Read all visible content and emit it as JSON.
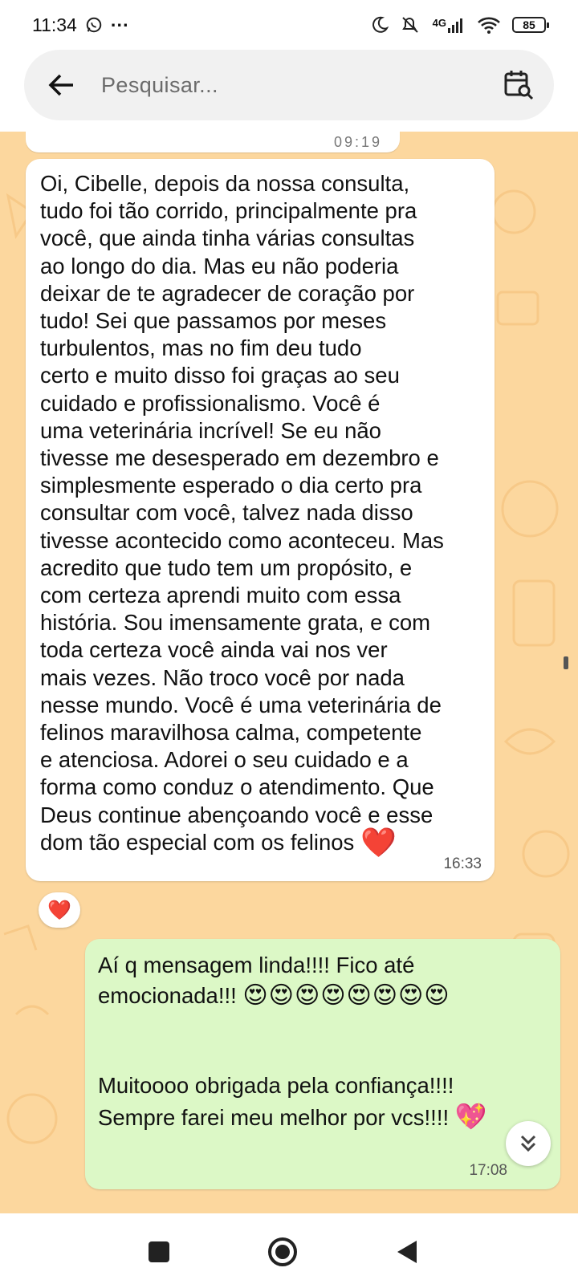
{
  "status_bar": {
    "time": "11:34",
    "dots": "···",
    "network": "4G",
    "battery": "85"
  },
  "search": {
    "placeholder": "Pesquisar..."
  },
  "chat": {
    "previous_time": "09:19",
    "incoming": {
      "text": "Oi, Cibelle, depois da nossa consulta,\ntudo foi tão corrido, principalmente pra\nvocê, que ainda tinha várias consultas\nao longo do dia. Mas eu não poderia\ndeixar de te agradecer de coração por\ntudo! Sei que passamos por meses\nturbulentos, mas no fim deu tudo\ncerto e muito disso foi graças ao seu\ncuidado e profissionalismo. Você é\numa veterinária incrível! Se eu não\ntivesse me desesperado em dezembro e\nsimplesmente esperado o dia certo pra\nconsultar com você, talvez nada disso\ntivesse acontecido como aconteceu. Mas\nacredito que tudo tem um propósito, e\ncom certeza aprendi muito com essa\nhistória. Sou imensamente grata, e com\ntoda certeza você ainda vai nos ver\nmais vezes. Não troco você por nada\nnesse mundo. Você é uma veterinária de\nfelinos maravilhosa calma, competente\ne atenciosa. Adorei o seu cuidado e a\nforma como conduz o atendimento. Que\nDeus continue abençoando você e esse\ndom tão especial com os felinos",
      "trailing_emoji": "❤️",
      "time": "16:33",
      "reaction": "❤️"
    },
    "outgoing": {
      "line1": "Aí q mensagem linda!!!! Fico até",
      "line2": "emocionada!!!",
      "emojis": "😍😍😍😍😍😍😍😍",
      "line3": "Muitoooo obrigada pela confiança!!!!",
      "line4": "Sempre farei meu melhor por vcs!!!!",
      "trailing_emoji": "💖",
      "time": "17:08"
    }
  },
  "colors": {
    "chat_background": "#fcd79e",
    "incoming_bubble": "#ffffff",
    "outgoing_bubble": "#dcf8c6",
    "heart": "#e11d2a"
  }
}
